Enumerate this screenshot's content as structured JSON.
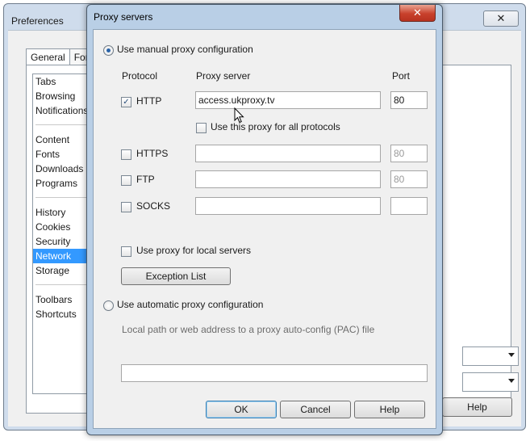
{
  "preferences": {
    "title": "Preferences",
    "close_glyph": "✕",
    "tabs": [
      "General",
      "Forms"
    ],
    "categories": [
      [
        "Tabs",
        "Browsing",
        "Notifications"
      ],
      [
        "Content",
        "Fonts",
        "Downloads",
        "Programs"
      ],
      [
        "History",
        "Cookies",
        "Security",
        "Network",
        "Storage"
      ],
      [
        "Toolbars",
        "Shortcuts"
      ]
    ],
    "selected_category": "Network",
    "help_label": "Help"
  },
  "dialog": {
    "title": "Proxy servers",
    "close_glyph": "✕",
    "manual_label": "Use manual proxy configuration",
    "manual_selected": true,
    "headers": {
      "protocol": "Protocol",
      "server": "Proxy server",
      "port": "Port"
    },
    "protocols": [
      {
        "name": "HTTP",
        "checked": true,
        "server": "access.ukproxy.tv",
        "port": "80"
      },
      {
        "name": "HTTPS",
        "checked": false,
        "server": "",
        "port": "80"
      },
      {
        "name": "FTP",
        "checked": false,
        "server": "",
        "port": "80"
      },
      {
        "name": "SOCKS",
        "checked": false,
        "server": "",
        "port": ""
      }
    ],
    "all_protocols_label": "Use this proxy for all protocols",
    "local_servers_label": "Use proxy for local servers",
    "exception_list_label": "Exception List",
    "auto_label": "Use automatic proxy configuration",
    "auto_hint": "Local path or web address to a proxy auto-config (PAC) file",
    "pac_value": "",
    "ok_label": "OK",
    "cancel_label": "Cancel",
    "help_label": "Help"
  }
}
